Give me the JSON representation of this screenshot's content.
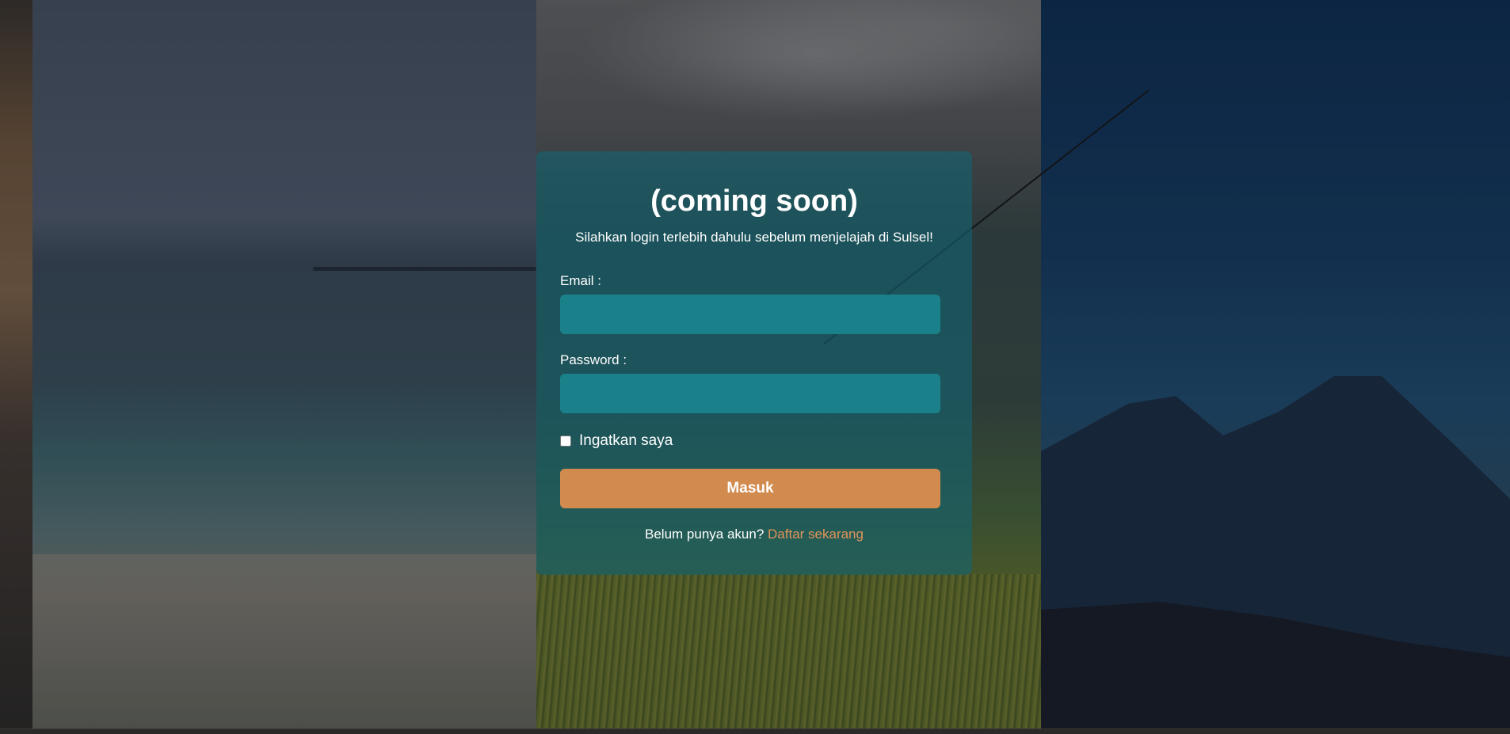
{
  "login": {
    "title": "(coming soon)",
    "subtitle": "Silahkan login terlebih dahulu sebelum menjelajah di Sulsel!",
    "email_label": "Email :",
    "email_value": "",
    "password_label": "Password :",
    "password_value": "",
    "remember_label": "Ingatkan saya",
    "remember_checked": false,
    "submit_label": "Masuk",
    "register_prompt": "Belum punya akun?",
    "register_link": "Daftar sekarang"
  },
  "colors": {
    "card_bg": "#146270",
    "input_bg": "#1a8089",
    "button_bg": "#d28b4f",
    "link": "#e0955a"
  }
}
